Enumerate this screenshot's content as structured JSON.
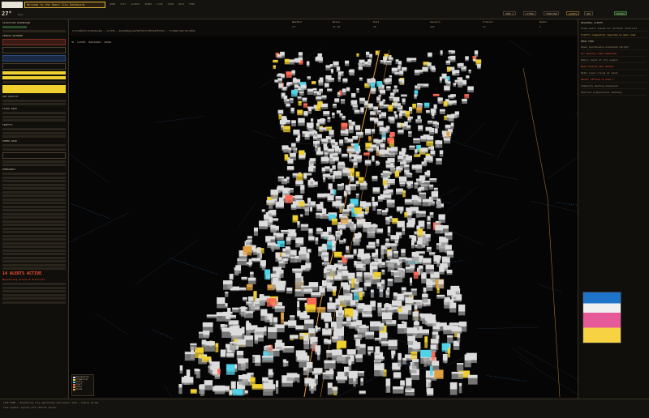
{
  "app": {
    "weather_temp": "27°",
    "weather_unit": "Rain",
    "toast_text": "Welcome to the Smart City Dashboard",
    "nav": [
      "HOME",
      "CITY",
      "ALERTS",
      "ZONES",
      "LIVE",
      "VIEW",
      "DATA",
      "FEED"
    ]
  },
  "header_stats": [
    {
      "label": "Weather",
      "value": "27°"
    },
    {
      "label": "Noise",
      "value": "45 dB"
    },
    {
      "label": "Dust",
      "value": "28"
    },
    {
      "label": "Sensors",
      "value": "420"
    },
    {
      "label": "Transit",
      "value": "12"
    },
    {
      "label": "Ranks",
      "value": "3"
    },
    {
      "label": "Rain",
      "value": "0.0"
    }
  ],
  "header_pills": [
    "ZONE A",
    "LAYERS",
    "TIMELINE",
    "ALERTS",
    "MAP",
    "EXPORT"
  ],
  "ticker": "ความเคลื่อนไหวล่าสุดของเมือง — SYSTEM — อัปเดตข้อมูลแบบเรียลไทม์จากเซ็นเซอร์ทั่วเมือง — ระบบติดตามสภาพแวดล้อม",
  "left_panel": {
    "title": "SITUATION DASHBOARD",
    "sections": [
      "SENSOR NETWORK",
      "AIR QUALITY",
      "FLOOD RISK",
      "TRAFFIC",
      "POWER GRID",
      "EMERGENCY"
    ],
    "alert": "14 ALERTS ACTIVE",
    "alert_sub": "Monitoring across 6 districts"
  },
  "map": {
    "toolbar": [
      "3D",
      "LAYERS",
      "BUILDINGS",
      "ROADS"
    ]
  },
  "legend": {
    "items": [
      {
        "label": "Residential",
        "color": "#e8e8e8"
      },
      {
        "label": "Commercial",
        "color": "#f0d030"
      },
      {
        "label": "Public",
        "color": "#4fd3e8"
      },
      {
        "label": "Alert",
        "color": "#ff6a55"
      },
      {
        "label": "Other",
        "color": "#e0a040"
      },
      {
        "label": "Roads",
        "color": "#f2a93b"
      }
    ]
  },
  "right_panel": {
    "title": "REGIONAL ALERTS",
    "feed_title": "NEWS FEED",
    "items": [
      "Flood watch issued for northern districts",
      "Traffic congestion reported on main road",
      "Power maintenance scheduled tonight",
      "Air quality index moderate",
      "Public event at city square",
      "Road closure near market",
      "Water level rising at canal",
      "Sensor offline in zone C",
      "Community meeting announced",
      "Festival preparations underway"
    ]
  },
  "bottom_bar": {
    "line1": "LIVE FEED — monitoring city operations and sensor data — status normal",
    "line2": "Last update: synced with central server"
  }
}
